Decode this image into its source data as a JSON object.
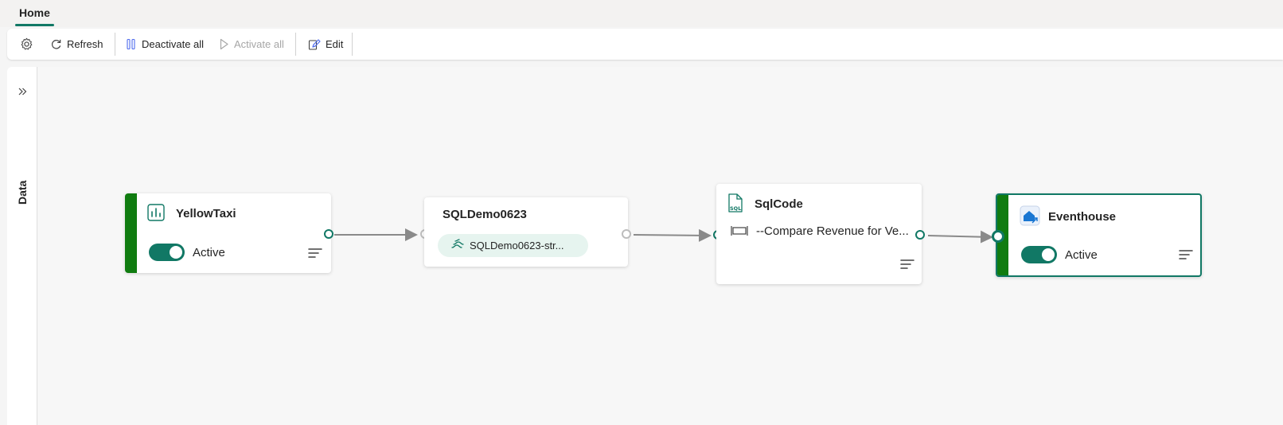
{
  "tabs": [
    {
      "label": "Home"
    }
  ],
  "toolbar": {
    "refresh_label": "Refresh",
    "deactivate_all_label": "Deactivate all",
    "activate_all_label": "Activate all",
    "edit_label": "Edit"
  },
  "side_panel": {
    "label": "Data"
  },
  "nodes": {
    "source": {
      "title": "YellowTaxi",
      "status": "Active",
      "icon": "chart-icon"
    },
    "stream": {
      "title": "SQLDemo0623",
      "pill_label": "SQLDemo0623-str...",
      "icon": "stream-icon"
    },
    "operator": {
      "title": "SqlCode",
      "code_preview": "--Compare Revenue for Ve...",
      "icon": "sql-file-icon"
    },
    "destination": {
      "title": "Eventhouse",
      "status": "Active",
      "icon": "eventhouse-icon"
    }
  },
  "colors": {
    "accent": "#117865",
    "active_bar": "#107c10"
  }
}
